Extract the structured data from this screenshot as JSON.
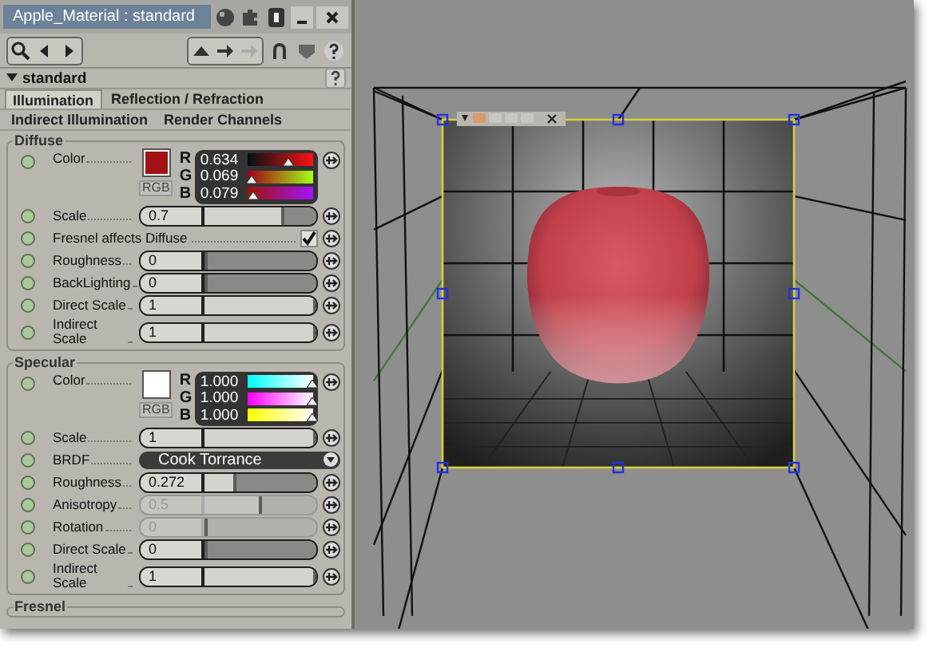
{
  "editor": {
    "title": "Apple_Material : standard",
    "rollout": "standard",
    "tabs": [
      [
        {
          "label": "Illumination",
          "selected": true
        },
        {
          "label": "Reflection / Refraction",
          "selected": false
        }
      ],
      [
        {
          "label": "Indirect Illumination",
          "selected": false
        },
        {
          "label": "Render Channels",
          "selected": false
        }
      ]
    ],
    "groups": [
      {
        "title": "Diffuse",
        "params": [
          {
            "kind": "color",
            "label": "Color",
            "mode": "RGB",
            "channels": [
              {
                "name": "R",
                "value": "0.634",
                "level": 0.634
              },
              {
                "name": "G",
                "value": "0.069",
                "level": 0.069
              },
              {
                "name": "B",
                "value": "0.079",
                "level": 0.079
              }
            ]
          },
          {
            "kind": "slider",
            "label": "Scale",
            "value": "0.7",
            "level": 0.7,
            "disabled": false
          },
          {
            "kind": "checkbox",
            "label": "Fresnel affects Diffuse",
            "checked": true
          },
          {
            "kind": "slider",
            "label": "Roughness",
            "value": "0",
            "level": 0,
            "disabled": false
          },
          {
            "kind": "slider",
            "label": "BackLighting",
            "value": "0",
            "level": 0,
            "disabled": false
          },
          {
            "kind": "slider",
            "label": "Direct Scale",
            "value": "1",
            "level": 1,
            "disabled": false
          },
          {
            "kind": "slider",
            "label": "Indirect Scale",
            "value": "1",
            "level": 1,
            "disabled": false
          }
        ]
      },
      {
        "title": "Specular",
        "params": [
          {
            "kind": "color",
            "label": "Color",
            "mode": "RGB",
            "channels": [
              {
                "name": "R",
                "value": "1.000",
                "level": 1
              },
              {
                "name": "G",
                "value": "1.000",
                "level": 1
              },
              {
                "name": "B",
                "value": "1.000",
                "level": 1
              }
            ]
          },
          {
            "kind": "slider",
            "label": "Scale",
            "value": "1",
            "level": 1,
            "disabled": false
          },
          {
            "kind": "dropdown",
            "label": "BRDF",
            "value": "Cook Torrance"
          },
          {
            "kind": "slider",
            "label": "Roughness",
            "value": "0.272",
            "level": 0.272,
            "disabled": false
          },
          {
            "kind": "slider",
            "label": "Anisotropy",
            "value": "0.5",
            "level": 0.5,
            "disabled": true
          },
          {
            "kind": "slider",
            "label": "Rotation",
            "value": "0",
            "level": 0,
            "disabled": true
          },
          {
            "kind": "slider",
            "label": "Direct Scale",
            "value": "0",
            "level": 0,
            "disabled": false
          },
          {
            "kind": "slider",
            "label": "Indirect Scale",
            "value": "1",
            "level": 1,
            "disabled": false
          }
        ]
      },
      {
        "title": "Fresnel"
      }
    ]
  }
}
